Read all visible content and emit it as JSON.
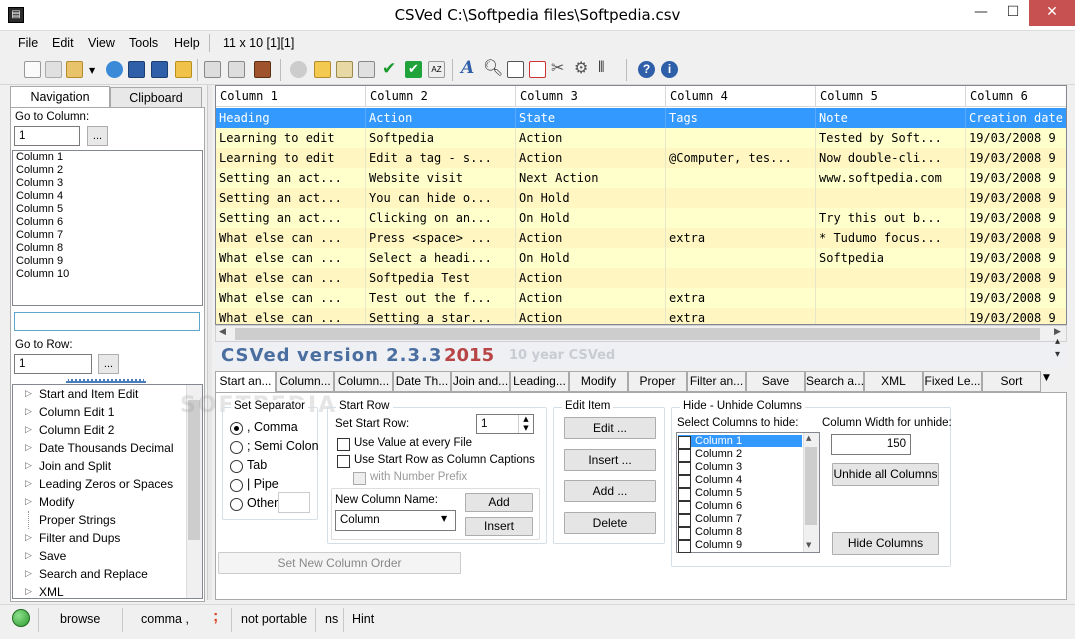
{
  "window": {
    "title": "CSVed C:\\Softpedia files\\Softpedia.csv",
    "app_icon": "csved-app-icon",
    "minimize": "—",
    "maximize": "☐",
    "close": "✕"
  },
  "menu": {
    "items": [
      "File",
      "Edit",
      "View",
      "Tools",
      "Help"
    ],
    "position": "11 x 10 [1][1]"
  },
  "toolbar": {
    "icons": [
      "new-file-icon",
      "copy-file-icon",
      "open-folder-icon",
      "refresh-icon",
      "save-icon",
      "save-as-icon",
      "folder-icon",
      "export-icon",
      "import-icon",
      "book-icon",
      "undo-icon",
      "paste-icon",
      "edit-icon",
      "replace-icon",
      "check-icon",
      "check-green-icon",
      "sort-az-icon",
      "font-icon",
      "search-icon",
      "columns-icon",
      "delete-icon",
      "tools-icon",
      "settings-icon",
      "split-icon",
      "help-icon",
      "info-icon"
    ]
  },
  "left": {
    "tabs": [
      "Navigation",
      "Clipboard"
    ],
    "goto_column_label": "Go to Column:",
    "goto_column_value": "1",
    "dots": "...",
    "columns": [
      "Column 1",
      "Column 2",
      "Column 3",
      "Column 4",
      "Column 5",
      "Column 6",
      "Column 7",
      "Column 8",
      "Column 9",
      "Column 10"
    ],
    "goto_row_label": "Go to Row:",
    "goto_row_value": "1",
    "tree": [
      "Start and Item Edit",
      "Column Edit 1",
      "Column Edit 2",
      "Date Thousands Decimal",
      "Join and Split",
      "Leading Zeros or Spaces",
      "Modify",
      "Proper Strings",
      "Filter and Dups",
      "Save",
      "Search and Replace",
      "XML"
    ]
  },
  "grid": {
    "headers": [
      "Column 1",
      "Column 2",
      "Column 3",
      "Column 4",
      "Column 5",
      "Column 6"
    ],
    "rows": [
      [
        "Heading",
        "Action",
        "State",
        "Tags",
        "Note",
        "Creation date"
      ],
      [
        "Learning to edit",
        "Softpedia",
        "Action",
        "",
        "Tested by Soft...",
        "19/03/2008 9"
      ],
      [
        "Learning to edit",
        "Edit a tag - s...",
        "Action",
        "@Computer, tes...",
        "Now double-cli...",
        "19/03/2008 9"
      ],
      [
        "Setting an act...",
        "Website visit",
        "Next Action",
        "",
        "www.softpedia.com",
        "19/03/2008 9"
      ],
      [
        "Setting an act...",
        "You can hide o...",
        "On Hold",
        "",
        "",
        "19/03/2008 9"
      ],
      [
        "Setting an act...",
        "Clicking on an...",
        "On Hold",
        "",
        "Try this out b...",
        "19/03/2008 9"
      ],
      [
        "What else can ...",
        "Press <space> ...",
        "Action",
        "extra",
        "* Tudumo focus...",
        "19/03/2008 9"
      ],
      [
        "What else can ...",
        "Select a headi...",
        "On Hold",
        "",
        "Softpedia",
        "19/03/2008 9"
      ],
      [
        "What else can ...",
        "Softpedia Test",
        "Action",
        "",
        "",
        "19/03/2008 9"
      ],
      [
        "What else can ...",
        "Test out the f...",
        "Action",
        "extra",
        "",
        "19/03/2008 9"
      ],
      [
        "What else can ...",
        "Setting a star...",
        "Action",
        "extra",
        "",
        "19/03/2008 9"
      ]
    ]
  },
  "banner": {
    "name": "CSVed",
    "version": "version 2.3.3",
    "year": "2015",
    "tagline": "10 year CSVed"
  },
  "tabs": [
    "Start an...",
    "Column...",
    "Column...",
    "Date Th...",
    "Join and...",
    "Leading...",
    "Modify",
    "Proper",
    "Filter an...",
    "Save",
    "Search a...",
    "XML",
    "Fixed Le...",
    "Sort"
  ],
  "panel": {
    "separator": {
      "title": "Set Separator",
      "options": [
        ", Comma",
        "; Semi Colon",
        "Tab",
        "| Pipe",
        "Other"
      ],
      "selected": ", Comma"
    },
    "start_row": {
      "title": "Start Row",
      "set_label": "Set Start Row:",
      "value": "1",
      "use_every_file": "Use Value at every File",
      "use_captions": "Use Start Row as Column Captions",
      "number_prefix": "with Number Prefix",
      "new_col_label": "New Column Name:",
      "new_col_value": "Column",
      "add": "Add",
      "insert": "Insert"
    },
    "edit_item": {
      "title": "Edit Item",
      "buttons": [
        "Edit ...",
        "Insert ...",
        "Add ...",
        "Delete"
      ]
    },
    "hide": {
      "title": "Hide - Unhide Columns",
      "select_label": "Select Columns to hide:",
      "columns": [
        "Column 1",
        "Column 2",
        "Column 3",
        "Column 4",
        "Column 5",
        "Column 6",
        "Column 7",
        "Column 8",
        "Column 9"
      ],
      "width_label": "Column Width for unhide:",
      "width_value": "150",
      "unhide_all": "Unhide all Columns",
      "hide_btn": "Hide Columns"
    },
    "set_order": "Set New Column Order"
  },
  "status": {
    "mode": "browse",
    "separator": "comma ,",
    "sep_char": ";",
    "portable": "not portable",
    "ns": "ns",
    "hint": "Hint"
  }
}
